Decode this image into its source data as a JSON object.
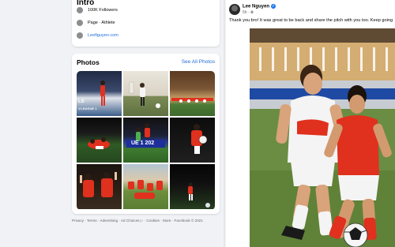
{
  "intro": {
    "title": "Intro",
    "followers": "100K Followers",
    "page_type": "Page · Athlete",
    "website": "Leefiguyen.com"
  },
  "photos": {
    "title": "Photos",
    "see_all": "See All Photos",
    "items": [
      {
        "name": "photo-1",
        "caption": "LS",
        "caption2": "V.LEAGUE 1"
      },
      {
        "name": "photo-2"
      },
      {
        "name": "photo-3"
      },
      {
        "name": "photo-4"
      },
      {
        "name": "photo-5",
        "caption": "UE 1 202"
      },
      {
        "name": "photo-6"
      },
      {
        "name": "photo-7"
      },
      {
        "name": "photo-8"
      },
      {
        "name": "photo-9"
      }
    ]
  },
  "footer": {
    "text": "Privacy · Terms · Advertising · Ad Choices ▷ · Cookies · More · Facebook © 2021"
  },
  "post": {
    "author": "Lee Nguyen",
    "time": "5h",
    "visibility_icon": "globe-icon",
    "text": "Thank you bro! It was great to be back and share the pitch with you too. Keep going"
  },
  "colors": {
    "page_bg": "#f0f2f5",
    "link_blue": "#216fdb",
    "verified_blue": "#1877f2",
    "jersey_red": "#e0301e"
  }
}
